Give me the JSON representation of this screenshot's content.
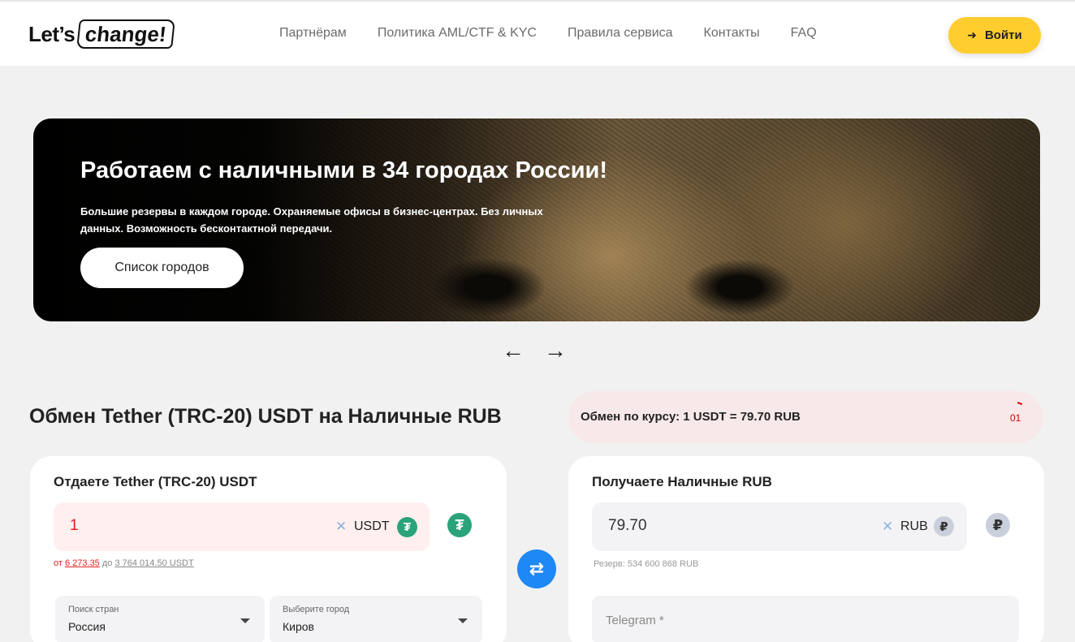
{
  "header": {
    "logo_lets": "Let’s",
    "logo_change": "change!",
    "nav": [
      "Партнёрам",
      "Политика AML/CTF & KYC",
      "Правила сервиса",
      "Контакты",
      "FAQ"
    ],
    "login_label": "Войти",
    "login_icon": "login-arrow-icon"
  },
  "banner": {
    "title": "Работаем с наличными в 34 городах России!",
    "subtitle": "Большие резервы в каждом городе. Охраняемые офисы в бизнес-центрах. Без личных данных. Возможность бесконтактной передачи.",
    "button_label": "Список городов",
    "prev_arrow": "←",
    "next_arrow": "→"
  },
  "exchange": {
    "title": "Обмен Tether (TRC-20) USDT на Наличные RUB",
    "rate_text": "Обмен по курсу: 1 USDT = 79.70 RUB",
    "timer": "01",
    "swap_icon": "⇄"
  },
  "give": {
    "label": "Отдаете Tether (TRC-20) USDT",
    "amount": "1",
    "clear": "✕",
    "currency": "USDT",
    "coin_glyph": "₮",
    "limit_from_prefix": "от ",
    "limit_from": "6 273.35",
    "limit_to_prefix": " до ",
    "limit_to": "3 764 014.50 USDT",
    "country_label": "Поиск стран",
    "country_value": "Россия",
    "city_label": "Выберите город",
    "city_value": "Киров"
  },
  "receive": {
    "label": "Получаете Наличные RUB",
    "amount": "79.70",
    "clear": "✕",
    "currency": "RUB",
    "coin_glyph": "₽",
    "reserve": "Резерв: 534 600 868 RUB",
    "telegram_placeholder": "Telegram *"
  },
  "colors": {
    "accent_yellow": "#ffce2e",
    "swap_blue": "#1e88f5",
    "usdt_green": "#2aa37a",
    "error_red": "#e02020"
  }
}
